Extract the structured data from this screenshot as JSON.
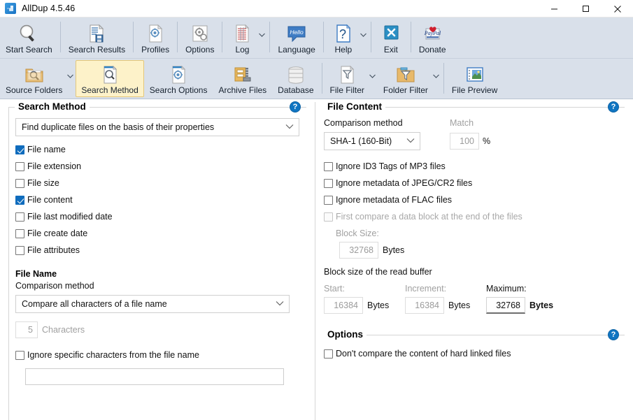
{
  "window": {
    "title": "AllDup 4.5.46",
    "app_icon": "alldup-logo-icon",
    "minimize_label": "–",
    "maximize_label": "□",
    "close_label": "✕"
  },
  "toolbar_main": [
    {
      "label": "Start Search",
      "icon": "magnifier-icon",
      "dropdown": false,
      "selected": false
    },
    {
      "label": "Search Results",
      "icon": "document-save-icon",
      "dropdown": false,
      "selected": false
    },
    {
      "label": "Profiles",
      "icon": "document-gear-icon",
      "dropdown": false,
      "selected": false
    },
    {
      "label": "Options",
      "icon": "gear-settings-icon",
      "dropdown": false,
      "selected": false
    },
    {
      "label": "Log",
      "icon": "log-list-icon",
      "dropdown": true,
      "selected": false
    },
    {
      "label": "Language",
      "icon": "speech-bubble-icon",
      "dropdown": false,
      "selected": false,
      "icon_text": "Hello"
    },
    {
      "label": "Help",
      "icon": "question-document-icon",
      "dropdown": true,
      "selected": false
    },
    {
      "label": "Exit",
      "icon": "close-x-icon",
      "dropdown": false,
      "selected": false
    },
    {
      "label": "Donate",
      "icon": "paypal-heart-icon",
      "dropdown": false,
      "selected": false,
      "icon_text": "PayPal"
    }
  ],
  "toolbar_secondary": [
    {
      "label": "Source Folders",
      "icon": "folder-search-icon",
      "dropdown": true,
      "selected": false
    },
    {
      "label": "Search Method",
      "icon": "document-search-icon",
      "dropdown": false,
      "selected": true
    },
    {
      "label": "Search Options",
      "icon": "document-gear-icon",
      "dropdown": false,
      "selected": false
    },
    {
      "label": "Archive Files",
      "icon": "archive-zip-icon",
      "dropdown": false,
      "selected": false
    },
    {
      "label": "Database",
      "icon": "database-icon",
      "dropdown": false,
      "selected": false
    },
    {
      "label": "File Filter",
      "icon": "document-funnel-icon",
      "dropdown": true,
      "selected": false
    },
    {
      "label": "Folder Filter",
      "icon": "folder-funnel-icon",
      "dropdown": true,
      "selected": false
    },
    {
      "label": "File Preview",
      "icon": "image-preview-icon",
      "dropdown": false,
      "selected": false
    }
  ],
  "search_method": {
    "group_title": "Search Method",
    "help_glyph": "?",
    "method_combo": {
      "value": "Find duplicate files on the basis of their properties"
    },
    "criteria": [
      {
        "label": "File name",
        "checked": true,
        "disabled": false
      },
      {
        "label": "File extension",
        "checked": false,
        "disabled": false
      },
      {
        "label": "File size",
        "checked": false,
        "disabled": false
      },
      {
        "label": "File content",
        "checked": true,
        "disabled": false
      },
      {
        "label": "File last modified date",
        "checked": false,
        "disabled": false
      },
      {
        "label": "File create date",
        "checked": false,
        "disabled": false
      },
      {
        "label": "File attributes",
        "checked": false,
        "disabled": false
      }
    ],
    "file_name_heading": "File Name",
    "comparison_method_label": "Comparison method",
    "comparison_combo": {
      "value": "Compare all characters of a file name"
    },
    "characters_value": "5",
    "characters_label": "Characters",
    "ignore_chars": {
      "label": "Ignore specific characters from the file name",
      "checked": false
    },
    "ignore_chars_value": ""
  },
  "file_content": {
    "group_title": "File Content",
    "help_glyph": "?",
    "comparison_method_label": "Comparison method",
    "comparison_combo": {
      "value": "SHA-1 (160-Bit)"
    },
    "match_label": "Match",
    "match_value": "100",
    "match_unit": "%",
    "checks": [
      {
        "label": "Ignore ID3 Tags of MP3 files",
        "checked": false,
        "disabled": false
      },
      {
        "label": "Ignore metadata of JPEG/CR2 files",
        "checked": false,
        "disabled": false
      },
      {
        "label": "Ignore metadata of FLAC files",
        "checked": false,
        "disabled": false
      },
      {
        "label": "First compare a data block at the end of the files",
        "checked": false,
        "disabled": true
      }
    ],
    "block_size_label": "Block Size:",
    "block_size_value": "32768",
    "block_size_unit": "Bytes",
    "read_buffer_heading": "Block size of the read buffer",
    "buffer_fields": [
      {
        "label": "Start:",
        "value": "16384",
        "unit": "Bytes",
        "disabled": true
      },
      {
        "label": "Increment:",
        "value": "16384",
        "unit": "Bytes",
        "disabled": true
      },
      {
        "label": "Maximum:",
        "value": "32768",
        "unit": "Bytes",
        "disabled": false
      }
    ]
  },
  "options": {
    "group_title": "Options",
    "help_glyph": "?",
    "checks": [
      {
        "label": "Don't compare the content of hard linked files",
        "checked": false,
        "disabled": false
      }
    ]
  },
  "colors": {
    "ribbon_bg": "#d9e0ea",
    "selected_tab_bg": "#fdf2c9",
    "selected_tab_border": "#e3c77a",
    "accent_blue": "#0f6cbd",
    "help_badge": "#1075c2"
  }
}
